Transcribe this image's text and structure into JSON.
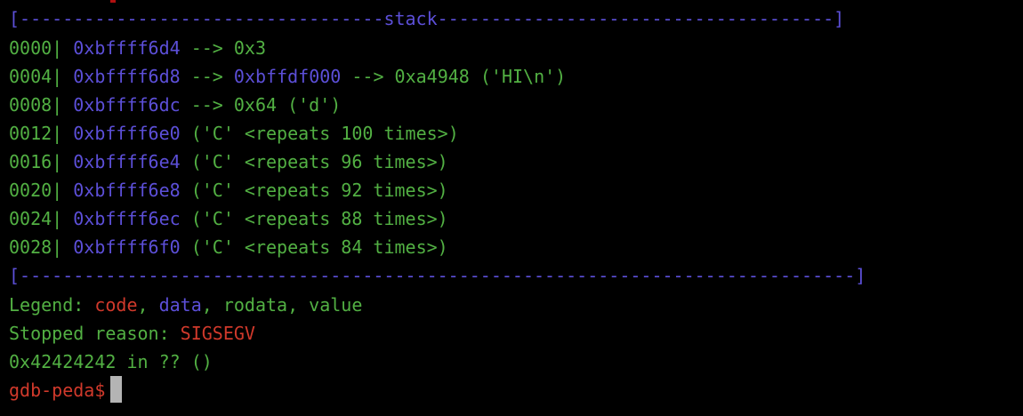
{
  "colors": {
    "background": "#000000",
    "green": "#52b043",
    "blue": "#5c4fd8",
    "red": "#d0392b",
    "cursor": "#b4b4b4"
  },
  "separator_top": {
    "left": "[----------------------------------",
    "title": "stack",
    "right": "-------------------------------------]"
  },
  "separator_bottom": "[------------------------------------------------------------------------------]",
  "stack_rows": [
    {
      "offset": "0000|",
      "addr": "0xbffff6d4",
      "rest": " --> 0x3"
    },
    {
      "offset": "0004|",
      "addr": "0xbffff6d8",
      "arrow": " --> ",
      "addr2": "0xbffdf000",
      "rest": " --> 0xa4948 ('HI\\n')"
    },
    {
      "offset": "0008|",
      "addr": "0xbffff6dc",
      "rest": " --> 0x64 ('d')"
    },
    {
      "offset": "0012|",
      "addr": "0xbffff6e0",
      "rest": " ('C' <repeats 100 times>)"
    },
    {
      "offset": "0016|",
      "addr": "0xbffff6e4",
      "rest": " ('C' <repeats 96 times>)"
    },
    {
      "offset": "0020|",
      "addr": "0xbffff6e8",
      "rest": " ('C' <repeats 92 times>)"
    },
    {
      "offset": "0024|",
      "addr": "0xbffff6ec",
      "rest": " ('C' <repeats 88 times>)"
    },
    {
      "offset": "0028|",
      "addr": "0xbffff6f0",
      "rest": " ('C' <repeats 84 times>)"
    }
  ],
  "legend": {
    "label": "Legend: ",
    "code": "code",
    "sep1": ", ",
    "data": "data",
    "rest": ", rodata, value"
  },
  "stopped": {
    "label": "Stopped reason: ",
    "reason": "SIGSEGV"
  },
  "location": "0x42424242 in ?? ()",
  "prompt": "gdb-peda$"
}
